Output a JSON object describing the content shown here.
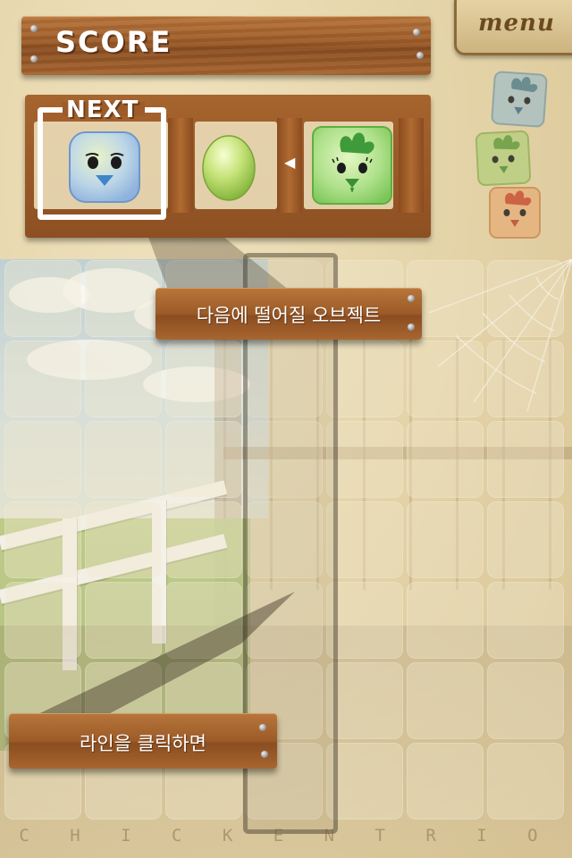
{
  "game": {
    "footer_title": "C H I C K E N   T R I O"
  },
  "header": {
    "score_label": "SCORE",
    "score_value": "",
    "menu_label": "menu"
  },
  "next_panel": {
    "label": "NEXT",
    "arrow": "◀",
    "pieces": [
      {
        "type": "blue-chick",
        "color": "#9cc6e8"
      },
      {
        "type": "green-egg",
        "color": "#b6dc6a"
      },
      {
        "type": "green-chicken",
        "color": "#9fd77a"
      }
    ]
  },
  "side_queue": [
    {
      "type": "blue-chicken",
      "color": "#8fb6c8"
    },
    {
      "type": "green-chicken",
      "color": "#a9c86a"
    },
    {
      "type": "red-chicken",
      "color": "#e2a06b"
    }
  ],
  "tutorial": {
    "next_object_caption": "다음에 떨어질 오브젝트",
    "click_line_caption": "라인을 클릭하면"
  },
  "board": {
    "columns": 7,
    "rows": 7,
    "highlighted_column": 4
  },
  "colors": {
    "wood": "#9b5a26",
    "parchment": "#e7d8b0",
    "text": "#ffffff"
  }
}
